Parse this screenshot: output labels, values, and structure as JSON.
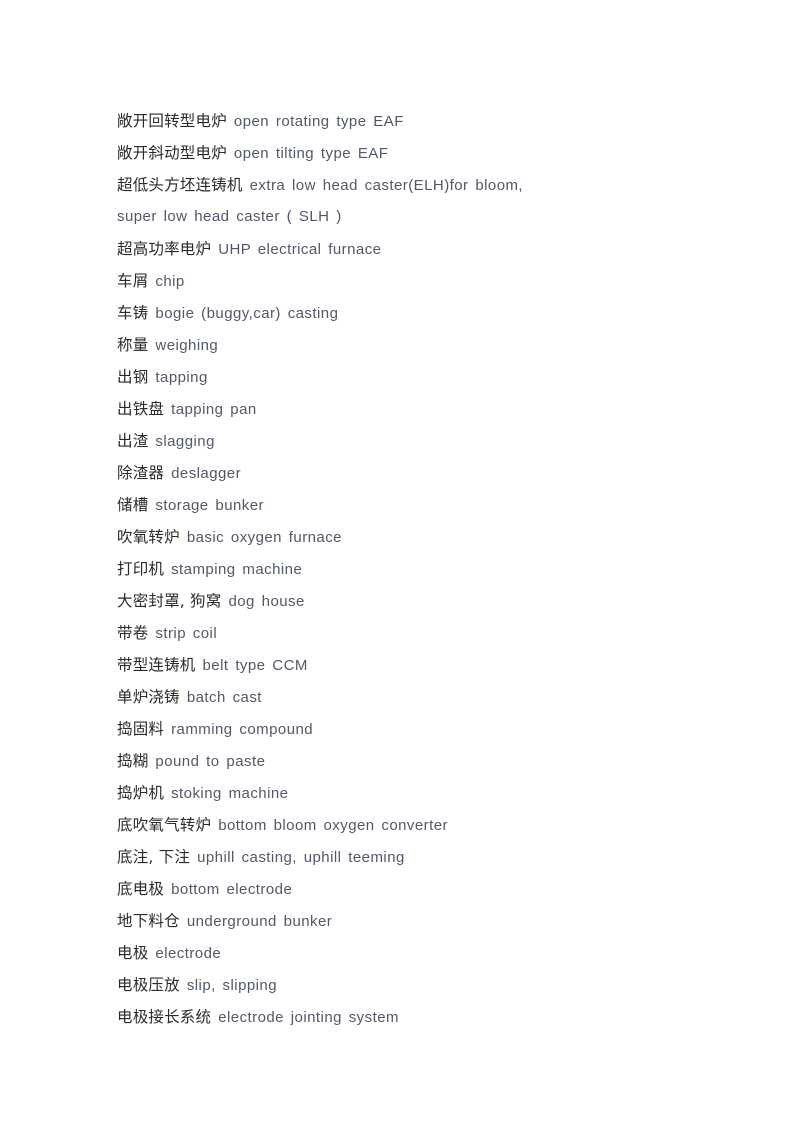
{
  "document": {
    "page_background": "#ffffff",
    "text_color_chinese": "#2b2b2b",
    "text_color_english": "#52586b",
    "entries": [
      {
        "zh": "敞开回转型电炉",
        "en": "open rotating type EAF"
      },
      {
        "zh": "敞开斜动型电炉",
        "en": "open tilting type EAF"
      },
      {
        "zh": "超低头方坯连铸机",
        "en": "extra low head caster(ELH)for bloom,"
      },
      {
        "zh": "",
        "en": "super low head caster ( SLH )",
        "continuation": true
      },
      {
        "zh": "超高功率电炉",
        "en": "UHP electrical furnace"
      },
      {
        "zh": "车屑",
        "en": "chip"
      },
      {
        "zh": "车铸",
        "en": "bogie (buggy,car) casting"
      },
      {
        "zh": "称量",
        "en": "weighing"
      },
      {
        "zh": "出钢",
        "en": "tapping"
      },
      {
        "zh": "出铁盘",
        "en": "tapping pan"
      },
      {
        "zh": "出渣",
        "en": "slagging"
      },
      {
        "zh": "除渣器",
        "en": "deslagger"
      },
      {
        "zh": "储槽",
        "en": "storage bunker"
      },
      {
        "zh": "吹氧转炉",
        "en": "basic oxygen furnace"
      },
      {
        "zh": "打印机",
        "en": "stamping machine"
      },
      {
        "zh": "大密封罩, 狗窝",
        "en": "dog house"
      },
      {
        "zh": "带卷",
        "en": "strip coil"
      },
      {
        "zh": "带型连铸机",
        "en": "belt type CCM"
      },
      {
        "zh": "单炉浇铸",
        "en": "batch cast"
      },
      {
        "zh": "捣固料",
        "en": "ramming compound"
      },
      {
        "zh": "捣糊",
        "en": "pound to paste"
      },
      {
        "zh": "捣炉机",
        "en": "stoking machine"
      },
      {
        "zh": "底吹氧气转炉",
        "en": "bottom bloom oxygen converter"
      },
      {
        "zh": "底注, 下注",
        "en": "uphill casting, uphill teeming"
      },
      {
        "zh": "底电极",
        "en": "bottom electrode"
      },
      {
        "zh": "地下料仓",
        "en": "underground bunker"
      },
      {
        "zh": "电极",
        "en": "electrode"
      },
      {
        "zh": "电极压放",
        "en": "slip, slipping"
      },
      {
        "zh": "电极接长系统",
        "en": "electrode jointing system"
      }
    ]
  }
}
